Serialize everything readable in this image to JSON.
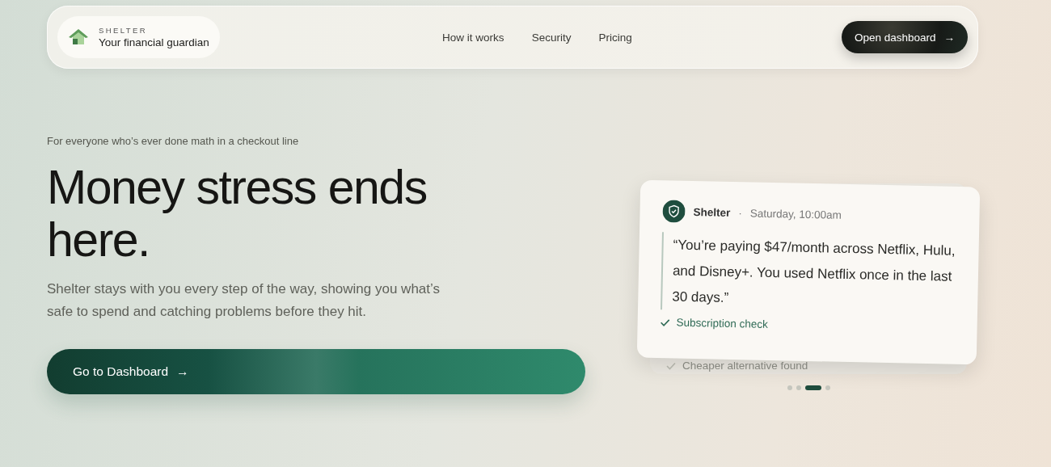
{
  "nav": {
    "brand": {
      "name": "SHELTER",
      "tagline": "Your financial guardian"
    },
    "links": [
      "How it works",
      "Security",
      "Pricing"
    ],
    "cta": {
      "label": "Open dashboard",
      "icon": "→"
    }
  },
  "hero": {
    "eyebrow": "For everyone who’s ever done math in a checkout line",
    "title": "Money stress ends here.",
    "body": "Shelter stays with you every step of the way, showing you what’s safe to spend and catching problems before they hit.",
    "cta": {
      "label": "Go to Dashboard",
      "icon": "→"
    }
  },
  "notification": {
    "sender": "Shelter",
    "separator": "·",
    "time": "Saturday, 10:00am",
    "quote": "“You’re paying $47/month across Netflix, Hulu, and Disney+. You used Netflix once in the last 30 days.”",
    "tag": "Subscription check",
    "back_card_tag": "Cheaper alternative found",
    "dots": [
      {
        "selected": false
      },
      {
        "selected": false
      },
      {
        "selected": true
      },
      {
        "selected": false
      }
    ]
  }
}
